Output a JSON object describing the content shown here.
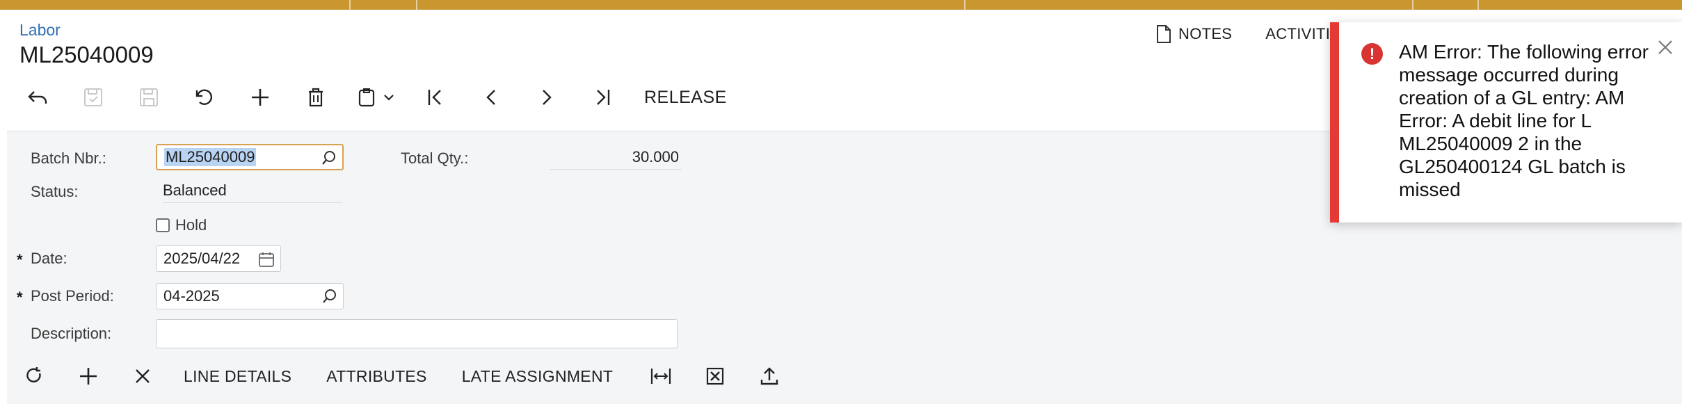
{
  "accent": {
    "topbar": "#c9962f",
    "link": "#2f6fb3",
    "error": "#e53935",
    "focus": "#d7a254"
  },
  "header": {
    "breadcrumb": "Labor",
    "title": "ML25040009"
  },
  "top_actions": {
    "notes": "NOTES",
    "activities": "ACTIVITI"
  },
  "toolbar": {
    "icons": [
      "back-icon",
      "save-close-icon",
      "save-icon",
      "undo-icon",
      "add-icon",
      "delete-icon",
      "copy-paste-icon",
      "first-record-icon",
      "previous-record-icon",
      "next-record-icon",
      "last-record-icon"
    ],
    "release": "RELEASE"
  },
  "form": {
    "batch_nbr": {
      "label": "Batch Nbr.:",
      "value": "ML25040009"
    },
    "status": {
      "label": "Status:",
      "value": "Balanced"
    },
    "hold": {
      "label": "Hold",
      "checked": false
    },
    "date": {
      "required": "*",
      "label": "Date:",
      "value": "2025/04/22"
    },
    "post_period": {
      "required": "*",
      "label": "Post Period:",
      "value": "04-2025"
    },
    "description": {
      "label": "Description:",
      "value": ""
    },
    "total_qty": {
      "label": "Total Qty.:",
      "value": "30.000"
    }
  },
  "grid_toolbar": {
    "line_details": "LINE DETAILS",
    "attributes": "ATTRIBUTES",
    "late_assignment": "LATE ASSIGNMENT"
  },
  "toast": {
    "icon": "!",
    "message": "AM Error: The following error message occurred during creation of a GL entry: AM Error: A debit line for L ML25040009 2 in the GL250400124 GL batch is missed"
  }
}
